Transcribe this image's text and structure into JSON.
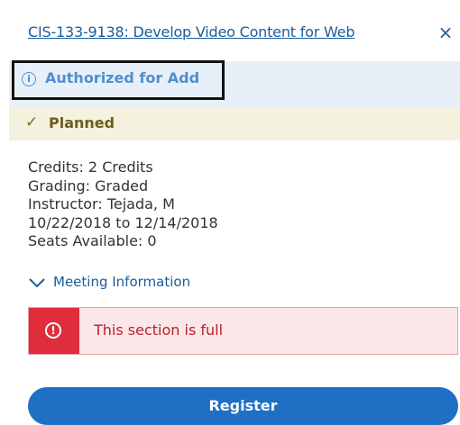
{
  "header": {
    "course_link": "CIS-133-9138: Develop Video Content for Web",
    "close_glyph": "×"
  },
  "authorization": {
    "icon": "info-icon",
    "icon_glyph": "i",
    "label": "Authorized for Add"
  },
  "plan_status": {
    "icon": "check-icon",
    "icon_glyph": "✓",
    "label": "Planned"
  },
  "details": {
    "credits": "Credits: 2 Credits",
    "grading": "Grading: Graded",
    "instructor": "Instructor: Tejada, M",
    "dates": "10/22/2018 to 12/14/2018",
    "seats": "Seats Available:  0"
  },
  "meeting": {
    "icon": "chevron-down-icon",
    "label": "Meeting Information"
  },
  "alert": {
    "icon": "exclamation-circle-icon",
    "icon_glyph": "!",
    "message": "This section is full"
  },
  "actions": {
    "register_label": "Register"
  },
  "colors": {
    "link": "#1a5c9c",
    "auth_text": "#4f8fd0",
    "auth_bg": "#e7f0f9",
    "planned_bg": "#f4f1de",
    "planned_text": "#6e5d1e",
    "alert_red": "#e02d3c",
    "alert_bg": "#fce7e8",
    "register_bg": "#1f6fc4"
  }
}
